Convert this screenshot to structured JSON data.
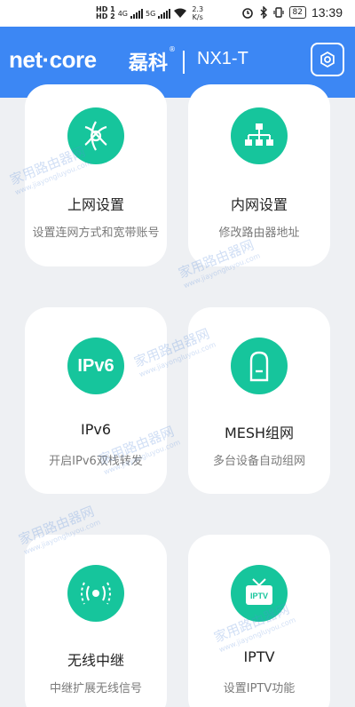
{
  "status_bar": {
    "network_top": "HD",
    "network_bottom": "HD",
    "sim1": "1",
    "sim2": "2",
    "net1": "4G",
    "net2": "5G",
    "speed_value": "2.3",
    "speed_unit": "K/s",
    "battery": "82",
    "time": "13:39"
  },
  "header": {
    "brand_logo": "net·core",
    "brand_cn": "磊科",
    "brand_reg": "®",
    "model": "NX1-T",
    "settings_icon": "gear-icon"
  },
  "cards": [
    {
      "title": "上网设置",
      "subtitle": "设置连网方式和宽带账号",
      "icon": "globe-icon"
    },
    {
      "title": "内网设置",
      "subtitle": "修改路由器地址",
      "icon": "network-topology-icon"
    },
    {
      "title": "IPv6",
      "subtitle": "开启IPv6双栈转发",
      "icon_text": "IPv6"
    },
    {
      "title": "MESH组网",
      "subtitle": "多台设备自动组网",
      "icon": "mesh-device-icon"
    },
    {
      "title": "无线中继",
      "subtitle": "中继扩展无线信号",
      "icon": "wireless-repeater-icon"
    },
    {
      "title": "IPTV",
      "subtitle": "设置IPTV功能",
      "icon_text": "IPTV"
    }
  ],
  "watermark": {
    "text": "家用路由器网",
    "url": "www.jiayongluyou.com"
  },
  "colors": {
    "header": "#3c87f4",
    "icon_bg": "#16c59c",
    "page_bg": "#eef0f3"
  }
}
